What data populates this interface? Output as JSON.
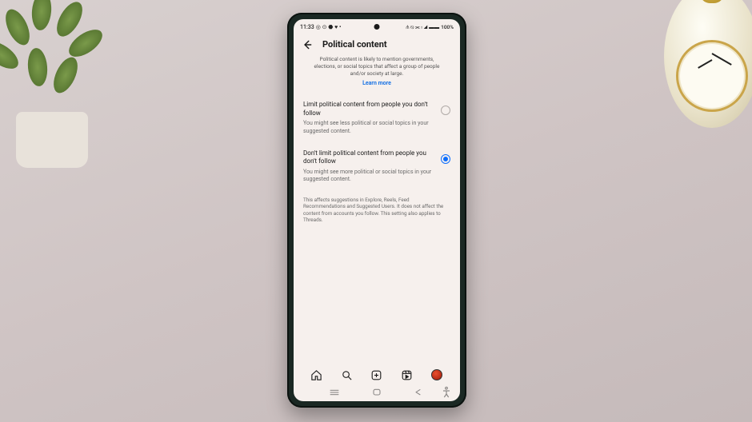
{
  "status": {
    "time": "11:33",
    "icons_left": "◎ ⊙ ⬣ ♥ •",
    "icons_right": "⫛ ⦰ ⫘ ⦂ ◢ ▬▬",
    "battery": "100%"
  },
  "header": {
    "title": "Political content"
  },
  "intro": {
    "text": "Political content is likely to mention governments, elections, or social topics that affect a group of people and/or society at large.",
    "learn_more": "Learn more"
  },
  "options": [
    {
      "title": "Limit political content from people you don't follow",
      "desc": "You might see less political or social topics in your suggested content.",
      "selected": false
    },
    {
      "title": "Don't limit political content from people you don't follow",
      "desc": "You might see more political or social topics in your suggested content.",
      "selected": true
    }
  ],
  "footnote": "This affects suggestions in Explore, Reels, Feed Recommendations and Suggested Users. It does not affect the content from accounts you follow. This setting also applies to Threads."
}
